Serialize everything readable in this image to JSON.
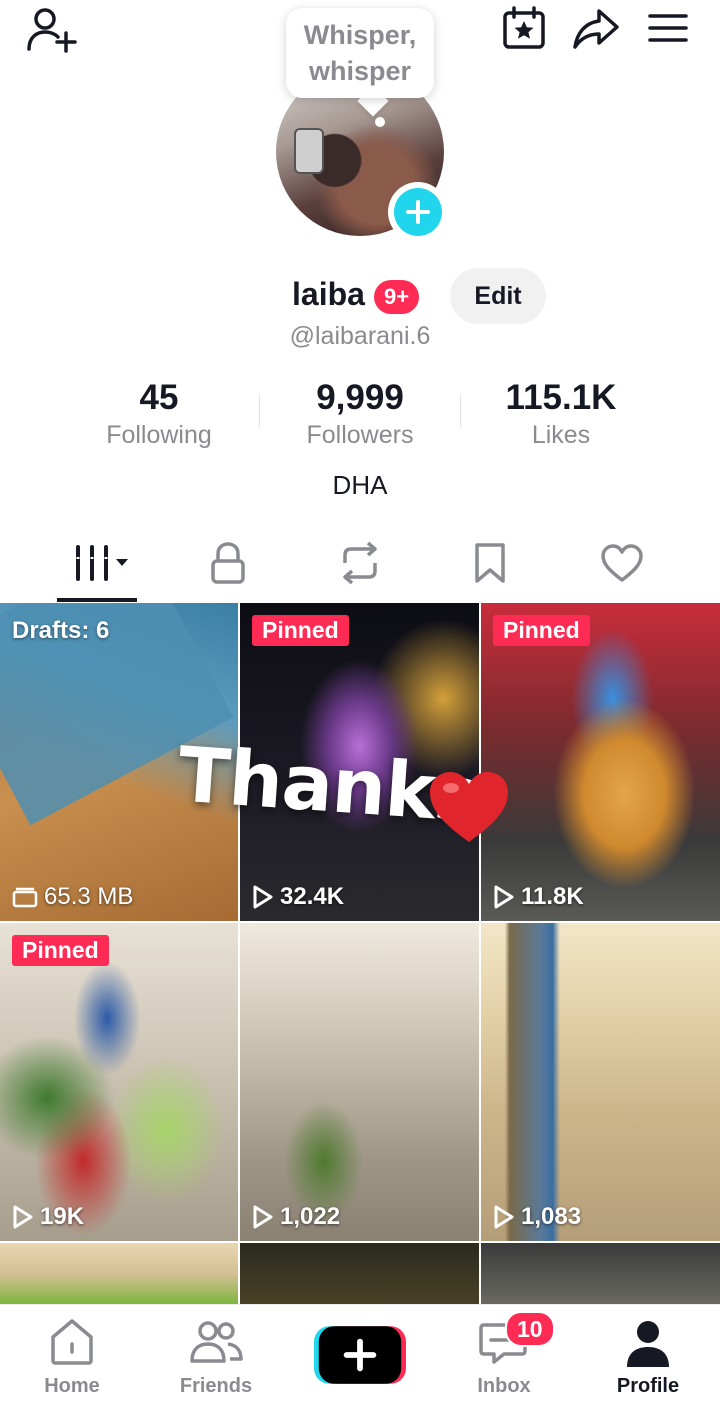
{
  "header": {
    "add_friend_icon": "person-plus-icon",
    "calendar_icon": "calendar-star-icon",
    "share_icon": "share-arrow-icon",
    "menu_icon": "hamburger-menu-icon"
  },
  "profile": {
    "tooltip": "Whisper,\nwhisper",
    "username": "laiba",
    "notification_badge": "9+",
    "edit_label": "Edit",
    "handle": "@laibarani.6",
    "bio": "DHA"
  },
  "stats": [
    {
      "value": "45",
      "label": "Following"
    },
    {
      "value": "9,999",
      "label": "Followers"
    },
    {
      "value": "115.1K",
      "label": "Likes"
    }
  ],
  "tabs": [
    "videos-grid-icon",
    "lock-icon",
    "repost-icon",
    "bookmark-icon",
    "heart-icon"
  ],
  "grid": {
    "drafts_label": "Drafts: 6",
    "drafts_size": "65.3 MB",
    "pinned_label": "Pinned",
    "thanks_text": "Thanks",
    "videos": [
      {
        "views": "32.4K",
        "pinned": true
      },
      {
        "views": "11.8K",
        "pinned": true
      },
      {
        "views": "19K",
        "pinned": true
      },
      {
        "views": "1,022",
        "pinned": false
      },
      {
        "views": "1,083",
        "pinned": false
      }
    ]
  },
  "nav": {
    "home": "Home",
    "friends": "Friends",
    "inbox": "Inbox",
    "inbox_badge": "10",
    "profile": "Profile"
  },
  "colors": {
    "accent": "#fe2c55",
    "cyan": "#20d5ec",
    "text": "#161823",
    "muted": "#8a8b91"
  }
}
